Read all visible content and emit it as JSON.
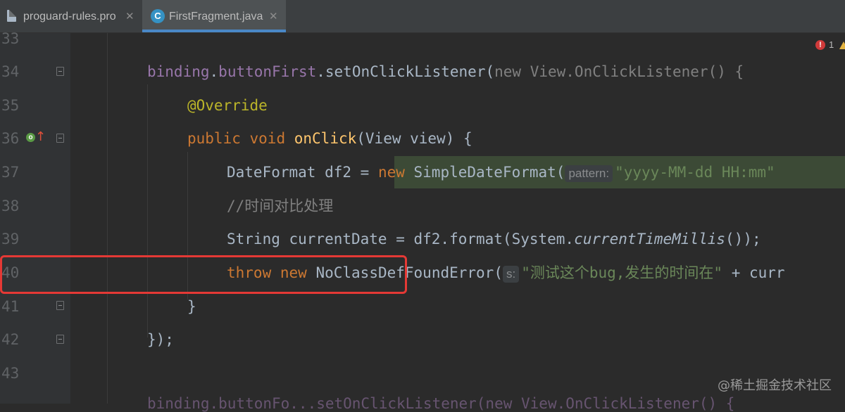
{
  "tabs": [
    {
      "label": "proguard-rules.pro",
      "close": "✕",
      "active": false
    },
    {
      "label": "FirstFragment.java",
      "close": "✕",
      "active": true
    }
  ],
  "colors": {
    "accent": "#4a88c7",
    "highlight_box": "#e53935"
  },
  "inspection": {
    "errors": "1"
  },
  "line_numbers": [
    "33",
    "34",
    "35",
    "36",
    "37",
    "38",
    "39",
    "40",
    "41",
    "42",
    "43"
  ],
  "code": {
    "l34": {
      "obj": "binding",
      "dot1": ".",
      "field": "buttonFirst",
      "call": ".setOnClickListener(",
      "new": "new",
      "rest": " View.OnClickListener() {"
    },
    "l35": {
      "annotation": "@Override"
    },
    "l36": {
      "public": "public",
      "void": "void",
      "name": "onClick",
      "rest": "(View view) {"
    },
    "l37": {
      "decl": "DateFormat df2 = ",
      "new": "new",
      "cls": " SimpleDateFormat(",
      "hint": "pattern:",
      "str": "\"yyyy-MM-dd HH:mm\""
    },
    "l38": {
      "comment": "//时间对比处理"
    },
    "l39": {
      "decl": "String currentDate = df2.format(System.",
      "method": "currentTimeMillis",
      "end": "());"
    },
    "l40": {
      "throw": "throw",
      "new": "new",
      "cls": " NoClassDefFoundError(",
      "hint": "s:",
      "str": "\"测试这个bug,发生的时间在\"",
      "rest": " + curr"
    },
    "l41": {
      "brace": "}"
    },
    "l42": {
      "brace": "});"
    },
    "l44": {
      "partial": "binding.buttonFo...setOnClickListener(new View.OnClickListener() {"
    }
  },
  "watermark": "@稀土掘金技术社区"
}
